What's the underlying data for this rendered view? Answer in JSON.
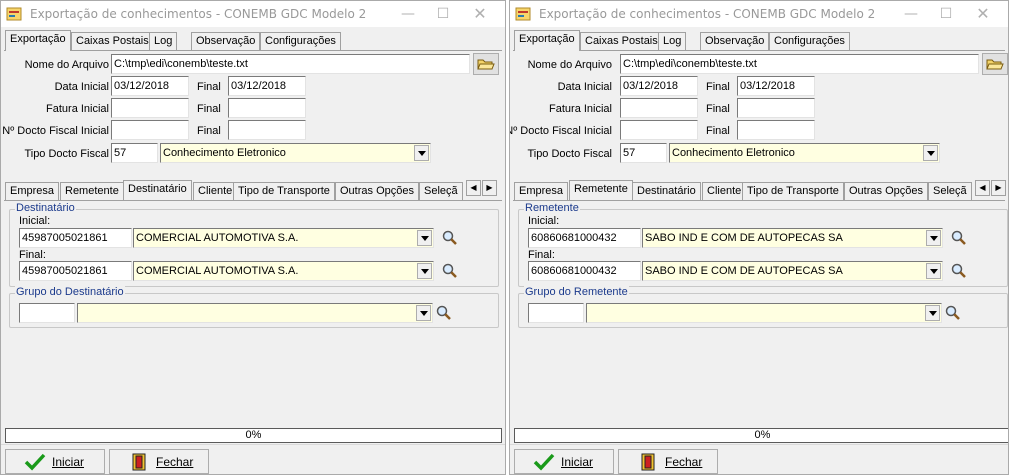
{
  "windows": [
    {
      "title": "Exportação de conhecimentos - CONEMB GDC Modelo 2",
      "main_tabs": [
        "Exportação",
        "Caixas Postais",
        "Log",
        "Observação",
        "Configurações"
      ],
      "form": {
        "nome_arquivo_label": "Nome do Arquivo",
        "nome_arquivo": "C:\\tmp\\edi\\conemb\\teste.txt",
        "data_inicial_label": "Data Inicial",
        "data_inicial": "03/12/2018",
        "final_label": "Final",
        "data_final": "03/12/2018",
        "fatura_inicial_label": "Fatura Inicial",
        "fatura_inicial": "",
        "fatura_final": "",
        "docto_fiscal_label": "Nº Docto Fiscal Inicial",
        "docto_inicial": "",
        "docto_final": "",
        "tipo_docto_label": "Tipo Docto Fiscal",
        "tipo_docto_code": "57",
        "tipo_docto_desc": "Conhecimento Eletronico"
      },
      "sub_tabs": [
        "Empresa",
        "Remetente",
        "Destinatário",
        "Cliente",
        "Tipo de Transporte",
        "Outras Opções",
        "Seleçã"
      ],
      "active_sub_tab": 2,
      "group1": {
        "title": "Destinatário",
        "inicial_label": "Inicial:",
        "inicial_code": "45987005021861",
        "inicial_name": "COMERCIAL AUTOMOTIVA S.A.",
        "final_label": "Final:",
        "final_code": "45987005021861",
        "final_name": "COMERCIAL AUTOMOTIVA S.A."
      },
      "group2": {
        "title": "Grupo do Destinatário",
        "code": "",
        "name": ""
      },
      "progress": "0%",
      "progress_value": 0,
      "buttons": {
        "iniciar": "Iniciar",
        "fechar": "Fechar"
      }
    },
    {
      "title": "Exportação de conhecimentos - CONEMB GDC Modelo 2",
      "main_tabs": [
        "Exportação",
        "Caixas Postais",
        "Log",
        "Observação",
        "Configurações"
      ],
      "form": {
        "nome_arquivo_label": "Nome do Arquivo",
        "nome_arquivo": "C:\\tmp\\edi\\conemb\\teste.txt",
        "data_inicial_label": "Data Inicial",
        "data_inicial": "03/12/2018",
        "final_label": "Final",
        "data_final": "03/12/2018",
        "fatura_inicial_label": "Fatura Inicial",
        "fatura_inicial": "",
        "fatura_final": "",
        "docto_fiscal_label": "Nº Docto Fiscal Inicial",
        "docto_inicial": "",
        "docto_final": "",
        "tipo_docto_label": "Tipo Docto Fiscal",
        "tipo_docto_code": "57",
        "tipo_docto_desc": "Conhecimento Eletronico"
      },
      "sub_tabs": [
        "Empresa",
        "Remetente",
        "Destinatário",
        "Cliente",
        "Tipo de Transporte",
        "Outras Opções",
        "Seleçã"
      ],
      "active_sub_tab": 1,
      "group1": {
        "title": "Remetente",
        "inicial_label": "Inicial:",
        "inicial_code": "60860681000432",
        "inicial_name": "SABO IND E COM DE AUTOPECAS SA",
        "final_label": "Final:",
        "final_code": "60860681000432",
        "final_name": "SABO IND E COM DE AUTOPECAS SA"
      },
      "group2": {
        "title": "Grupo do Remetente",
        "code": "",
        "name": ""
      },
      "progress": "0%",
      "progress_value": 0,
      "buttons": {
        "iniciar": "Iniciar",
        "fechar": "Fechar"
      }
    }
  ],
  "icons": {
    "app": "app-icon",
    "folder": "folder-icon",
    "search": "search-icon",
    "check": "check-icon",
    "exit": "exit-door-icon"
  },
  "colors": {
    "group_title": "#1b3a8c",
    "input_yellow": "#ffffe1",
    "check_green": "#1a9a1a"
  }
}
